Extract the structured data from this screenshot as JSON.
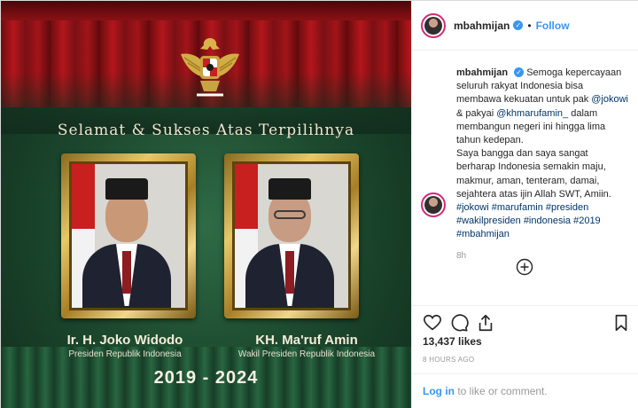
{
  "media": {
    "headline": "Selamat & Sukses Atas Terpilihnya",
    "left_name": "Ir. H. Joko Widodo",
    "left_role": "Presiden Republik Indonesia",
    "right_name": "KH. Ma'ruf Amin",
    "right_role": "Wakil Presiden Republik Indonesia",
    "years": "2019 - 2024",
    "icons": [
      "garuda-emblem"
    ]
  },
  "post": {
    "username": "mbahmijan",
    "follow_label": "Follow",
    "separator": "•",
    "caption_user": "mbahmijan",
    "caption_part1": "Semoga kepercayaan seluruh rakyat Indonesia bisa membawa kekuatan untuk pak",
    "mention1": "@jokowi",
    "caption_and": "& pakyai",
    "mention2": "@khmarufamin_",
    "caption_part2": "dalam membangun negeri ini hingga lima tahun kedepan.",
    "caption_part3": "Saya bangga dan saya sangat berharap Indonesia semakin maju, makmur, aman, tenteram, damai, sejahtera atas ijin Allah SWT, Amiin.",
    "hashtags": "#jokowi #marufamin #presiden #wakilpresiden #indonesia #2019 #mbahmijan",
    "time_ago": "8h",
    "likes": "13,437 likes",
    "posted": "8 HOURS AGO",
    "login_label": "Log in",
    "login_suffix": "to like or comment.",
    "icons": [
      "heart-icon",
      "comment-icon",
      "share-icon",
      "bookmark-icon",
      "add-circle-icon",
      "verified-icon"
    ]
  },
  "colors": {
    "accent": "#3897f0",
    "curtain": "#b3161c",
    "background": "#1d4a2f",
    "gold": "#e7c867"
  }
}
